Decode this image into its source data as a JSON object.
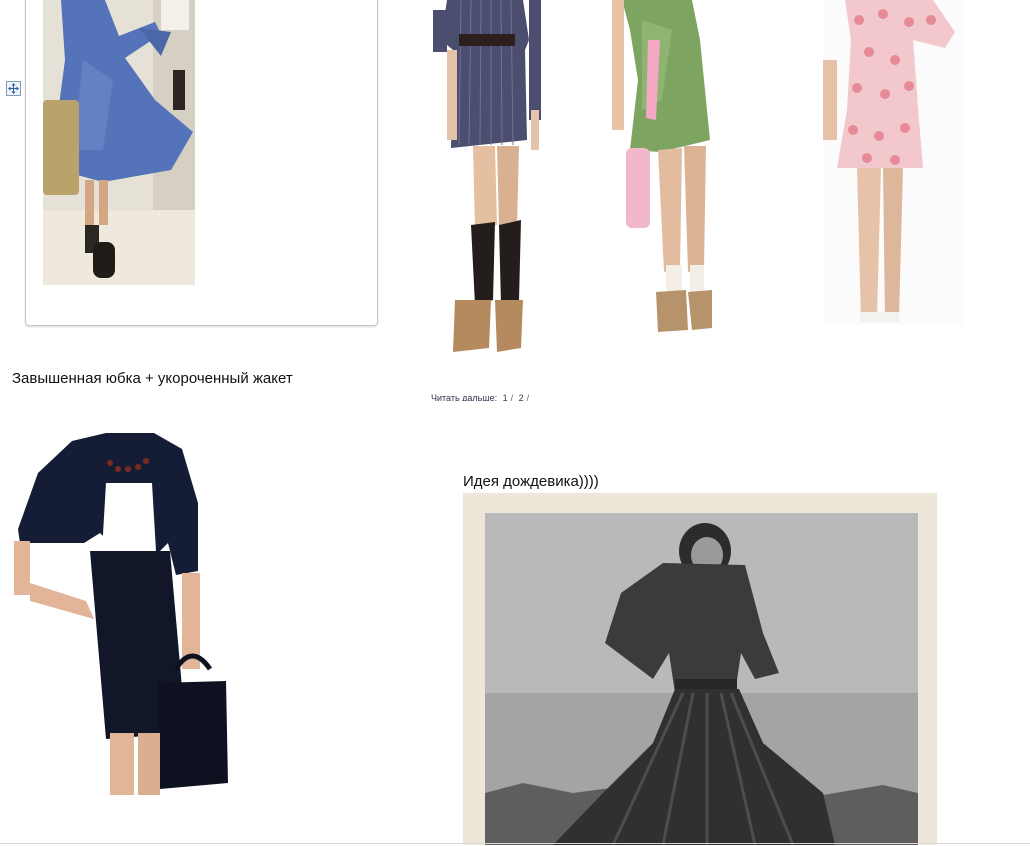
{
  "captions": {
    "skirt_jacket": "Завышенная юбка + укороченный жакет",
    "raincoat_idea": "Идея дождевика))))"
  },
  "read_more": {
    "label": "Читать дальше:",
    "pages": [
      "1",
      "2"
    ],
    "separator": "/"
  },
  "icons": {
    "move_handle": "move-arrows-icon"
  }
}
